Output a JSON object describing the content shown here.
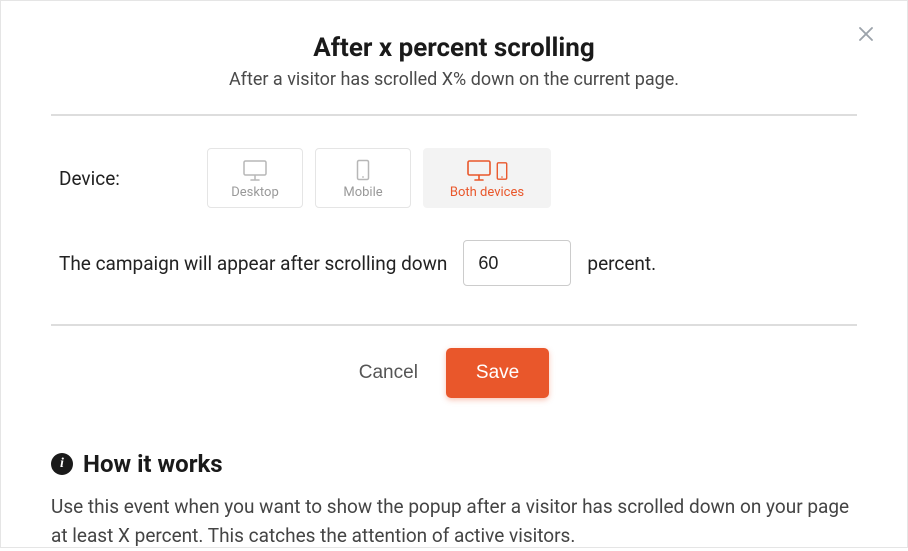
{
  "header": {
    "title": "After x percent scrolling",
    "subtitle": "After a visitor has scrolled X% down on the current page."
  },
  "close_icon": "×",
  "device": {
    "label": "Device:",
    "options": {
      "desktop": "Desktop",
      "mobile": "Mobile",
      "both": "Both devices"
    }
  },
  "scroll": {
    "before_text": "The campaign will appear after scrolling down",
    "value": "60",
    "after_text": "percent."
  },
  "actions": {
    "cancel": "Cancel",
    "save": "Save"
  },
  "how": {
    "info_glyph": "i",
    "title": "How it works",
    "body": "Use this event when you want to show the popup after a visitor has scrolled down on your page at least X percent. This catches the attention of active visitors."
  }
}
